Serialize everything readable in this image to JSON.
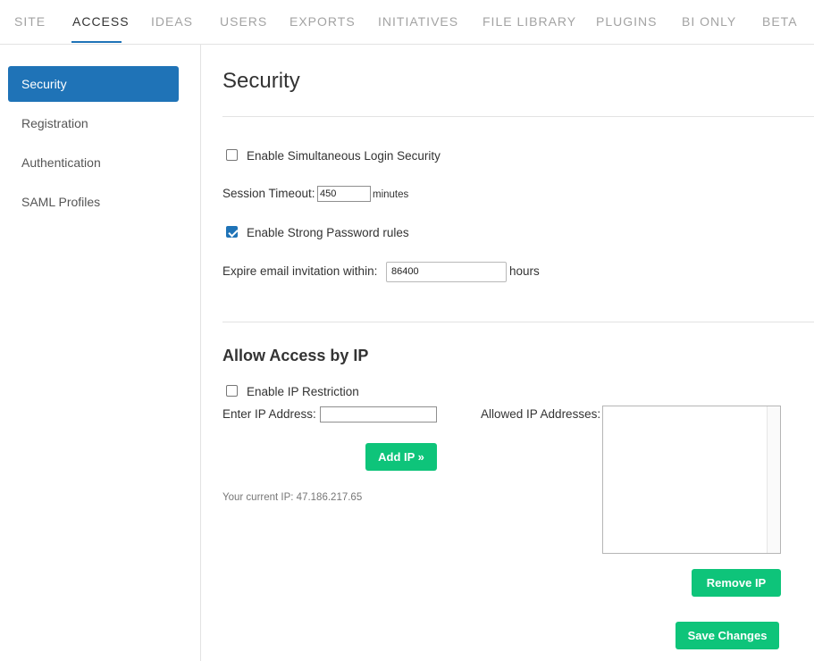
{
  "topnav": {
    "tabs": [
      "SITE",
      "ACCESS",
      "IDEAS",
      "USERS",
      "EXPORTS",
      "INITIATIVES",
      "FILE LIBRARY",
      "PLUGINS",
      "BI ONLY",
      "BETA"
    ],
    "active": "ACCESS"
  },
  "sidebar": {
    "items": [
      "Security",
      "Registration",
      "Authentication",
      "SAML Profiles"
    ],
    "active": "Security"
  },
  "security": {
    "title": "Security",
    "simultaneous_login_label": "Enable Simultaneous Login Security",
    "simultaneous_login_checked": false,
    "session_timeout_label": "Session Timeout:",
    "session_timeout_value": "450",
    "session_timeout_unit": "minutes",
    "strong_password_label": "Enable Strong Password rules",
    "strong_password_checked": true,
    "expire_invitation_label": "Expire email invitation within:",
    "expire_invitation_value": "86400",
    "expire_invitation_unit": "hours"
  },
  "ip_access": {
    "title": "Allow Access by IP",
    "restriction_label": "Enable IP Restriction",
    "restriction_checked": false,
    "enter_ip_label": "Enter IP Address:",
    "enter_ip_value": "",
    "add_ip_button": "Add IP »",
    "current_ip_text": "Your current IP: 47.186.217.65",
    "allowed_ips_label": "Allowed IP Addresses:",
    "allowed_ips": [],
    "remove_ip_button": "Remove IP"
  },
  "save_button": "Save Changes",
  "colors": {
    "primary": "#1f73b7",
    "success": "#0ec47a",
    "border": "#e3e3e3"
  }
}
